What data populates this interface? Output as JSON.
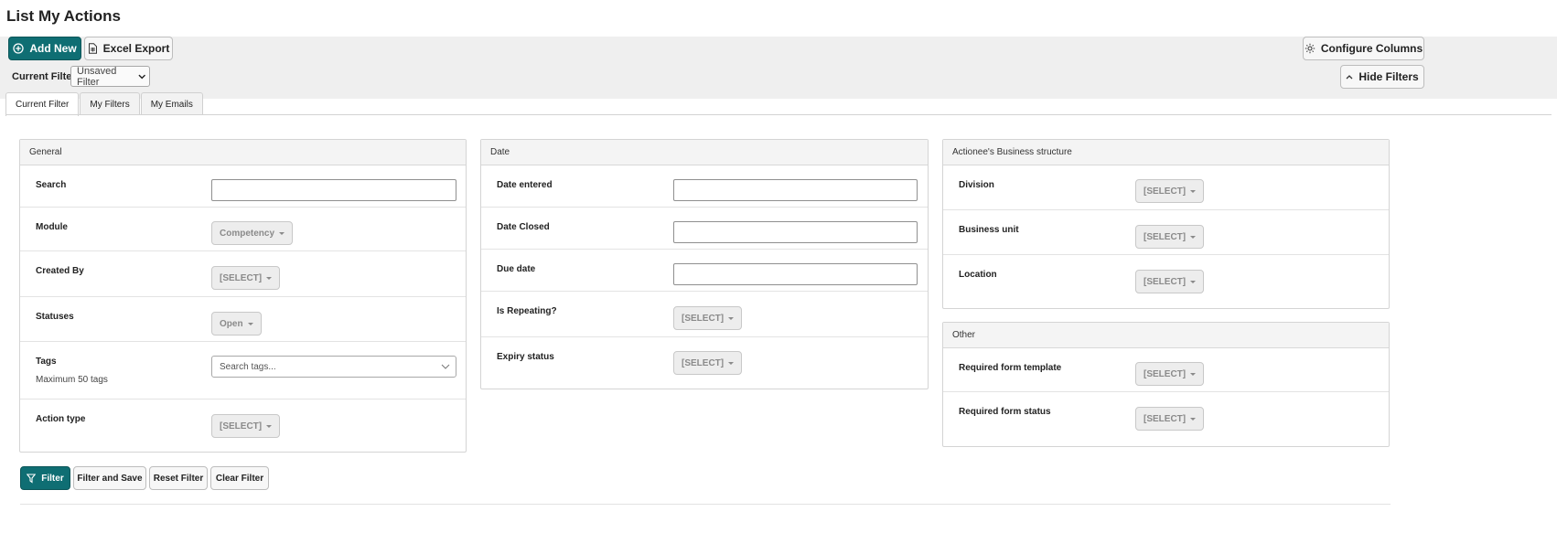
{
  "page": {
    "title": "List My Actions"
  },
  "toolbar": {
    "add_new": "Add New",
    "excel_export": "Excel Export",
    "configure_columns": "Configure Columns",
    "hide_filters": "Hide Filters",
    "current_filter_label": "Current Filter:",
    "current_filter_value": "Unsaved Filter"
  },
  "tabs": [
    {
      "label": "Current Filter",
      "active": true
    },
    {
      "label": "My Filters",
      "active": false
    },
    {
      "label": "My Emails",
      "active": false
    }
  ],
  "general": {
    "title": "General",
    "search_label": "Search",
    "search_value": "",
    "module_label": "Module",
    "module_value": "Competency",
    "created_by_label": "Created By",
    "created_by_value": "[SELECT]",
    "statuses_label": "Statuses",
    "statuses_value": "Open",
    "tags_label": "Tags",
    "tags_hint": "Maximum 50 tags",
    "tags_placeholder": "Search tags...",
    "action_type_label": "Action type",
    "action_type_value": "[SELECT]"
  },
  "date": {
    "title": "Date",
    "date_entered_label": "Date entered",
    "date_closed_label": "Date Closed",
    "due_date_label": "Due date",
    "is_repeating_label": "Is Repeating?",
    "is_repeating_value": "[SELECT]",
    "expiry_status_label": "Expiry status",
    "expiry_status_value": "[SELECT]"
  },
  "business": {
    "title": "Actionee's Business structure",
    "division_label": "Division",
    "division_value": "[SELECT]",
    "business_unit_label": "Business unit",
    "business_unit_value": "[SELECT]",
    "location_label": "Location",
    "location_value": "[SELECT]"
  },
  "other": {
    "title": "Other",
    "form_template_label": "Required form template",
    "form_template_value": "[SELECT]",
    "form_status_label": "Required form status",
    "form_status_value": "[SELECT]"
  },
  "actions": {
    "filter": "Filter",
    "filter_and_save": "Filter and Save",
    "reset_filter": "Reset Filter",
    "clear_filter": "Clear Filter"
  },
  "colors": {
    "primary": "#0f6e73",
    "toolbar_bg": "#efefef",
    "panel_border": "#d4d4d4"
  },
  "icons": {
    "add": "plus-circle-icon",
    "export": "spreadsheet-file-icon",
    "configure": "gear-icon",
    "hide": "chevron-up-icon",
    "dropdown": "chevron-down-icon",
    "filter": "funnel-icon"
  }
}
